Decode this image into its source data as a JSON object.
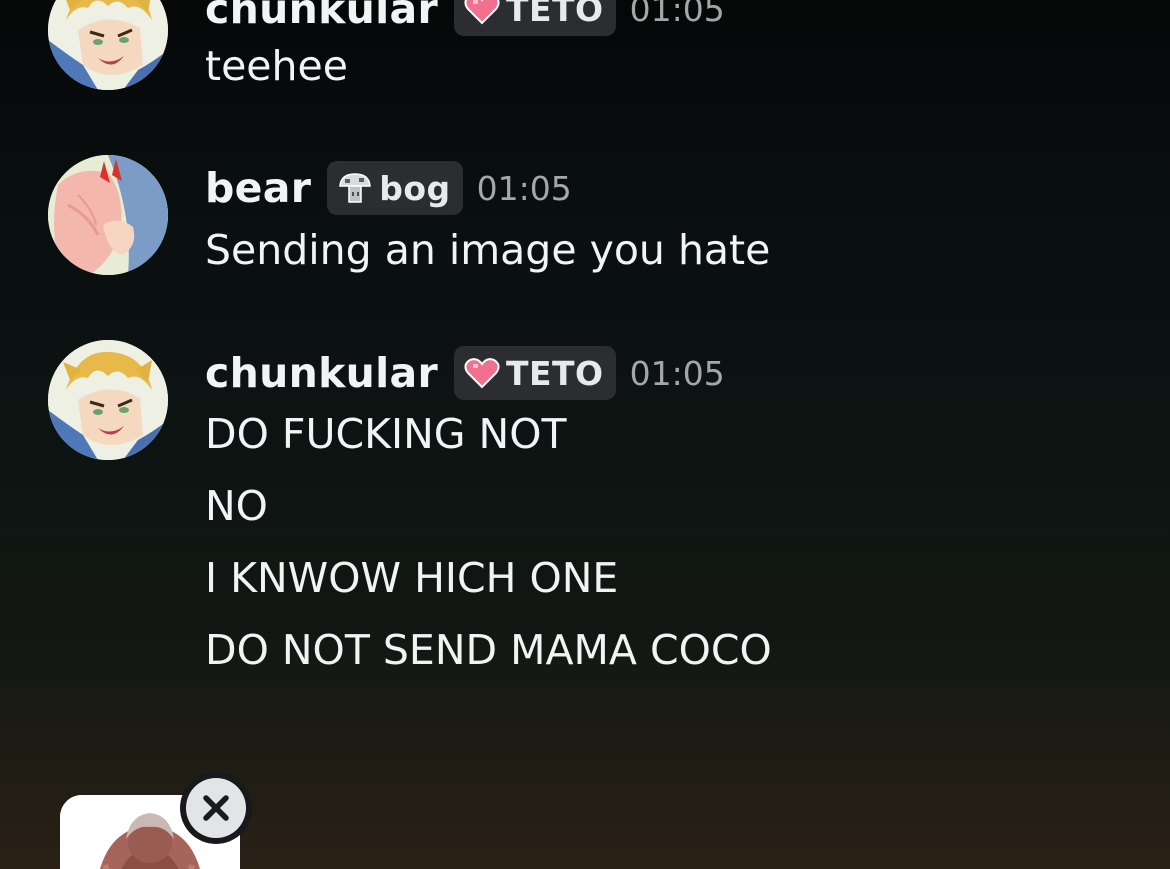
{
  "messages": [
    {
      "username": "chunkular",
      "tag": {
        "label": "TETO",
        "icon": "pink-heart-icon"
      },
      "time": "01:05",
      "lines": [
        "teehee"
      ]
    },
    {
      "username": "bear",
      "tag": {
        "label": "bog",
        "icon": "mushroom-icon"
      },
      "time": "01:05",
      "lines": [
        "Sending an image you hate"
      ]
    },
    {
      "username": "chunkular",
      "tag": {
        "label": "TETO",
        "icon": "pink-heart-icon"
      },
      "time": "01:05",
      "lines": [
        "DO FUCKING NOT",
        "NO",
        "I KNWOW HICH ONE",
        "DO NOT SEND MAMA COCO"
      ]
    }
  ],
  "composer": {
    "attachment": {
      "remove_icon": "close-icon"
    }
  },
  "colors": {
    "username": "#f2f3f5",
    "timestamp": "#a3a6ab",
    "tag_background": "#2b2d31",
    "heart": "#f0708e"
  }
}
